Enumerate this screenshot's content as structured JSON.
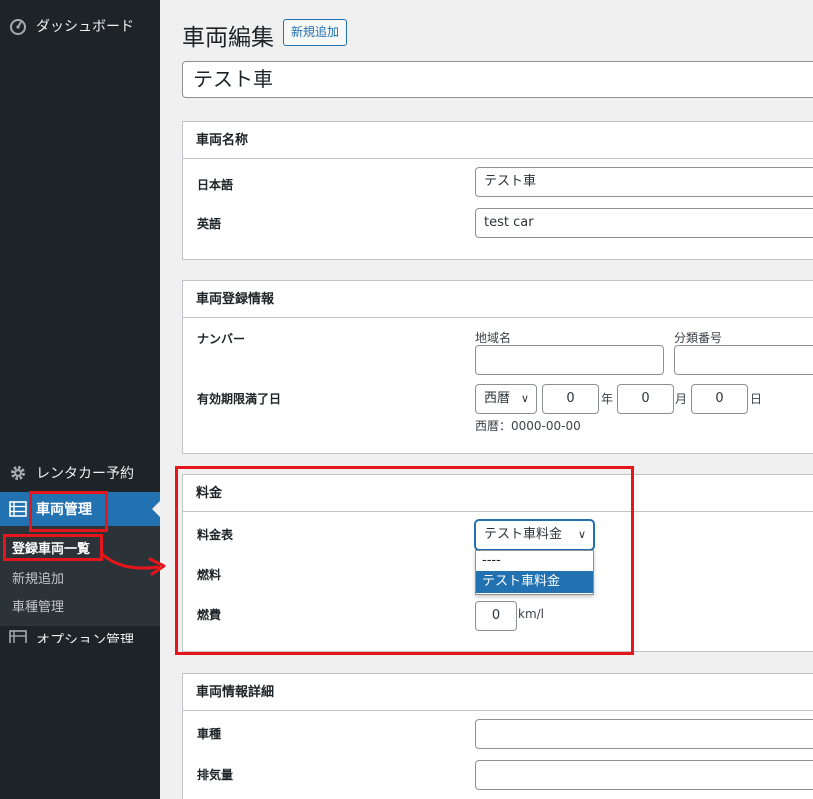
{
  "sidebar": {
    "dashboard": "ダッシュボード",
    "rentacar": "レンタカー予約",
    "vehicle_mgmt": "車両管理",
    "submenu": {
      "list": "登録車両一覧",
      "add_new": "新規追加",
      "vehicle_type": "車種管理"
    },
    "option_mgmt": "オプション管理"
  },
  "header": {
    "title": "車両編集",
    "add_new_button": "新規追加"
  },
  "post_title": "テスト車",
  "vehicle_name": {
    "heading": "車両名称",
    "japanese_label": "日本語",
    "japanese_value": "テスト車",
    "english_label": "英語",
    "english_value": "test car"
  },
  "registration": {
    "heading": "車両登録情報",
    "number_label": "ナンバー",
    "region_label": "地域名",
    "region_value": "",
    "class_label": "分類番号",
    "class_value": "",
    "expiry_label": "有効期限満了日",
    "era_value": "西暦",
    "year_value": "0",
    "year_unit": "年",
    "month_value": "0",
    "month_unit": "月",
    "day_value": "0",
    "day_unit": "日",
    "date_note": "西暦：0000-00-00"
  },
  "fee": {
    "heading": "料金",
    "table_label": "料金表",
    "table_selected": "テスト車料金",
    "options": [
      "----",
      "テスト車料金"
    ],
    "fuel_label": "燃料",
    "economy_label": "燃費",
    "economy_value": "0",
    "economy_unit": "km/l"
  },
  "detail": {
    "heading": "車両情報詳細",
    "type_label": "車種",
    "type_value": "",
    "displacement_label": "排気量",
    "displacement_value": ""
  },
  "colors": {
    "sidebar_bg": "#1d2327",
    "accent": "#2271b1",
    "annotation_red": "#e4161c"
  }
}
